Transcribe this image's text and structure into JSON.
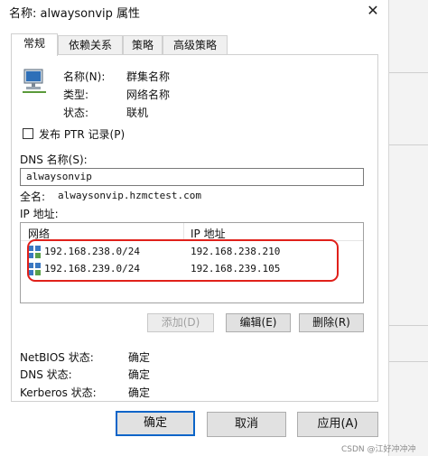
{
  "window": {
    "title": "名称: alwaysonvip 属性",
    "close_glyph": "✕"
  },
  "tabs": [
    {
      "label": "常规",
      "active": true
    },
    {
      "label": "依赖关系",
      "active": false
    },
    {
      "label": "策略",
      "active": false
    },
    {
      "label": "高级策略",
      "active": false
    }
  ],
  "general": {
    "name_label": "名称(N):",
    "name_value": "群集名称",
    "type_label": "类型:",
    "type_value": "网络名称",
    "status_label": "状态:",
    "status_value": "联机",
    "publish_ptr_label": "发布 PTR 记录(P)",
    "publish_ptr_checked": false,
    "dns_name_label": "DNS 名称(S):",
    "dns_name_value": "alwaysonvip",
    "fqdn_label": "全名:",
    "fqdn_value": "alwaysonvip.hzmctest.com",
    "ip_section_label": "IP 地址:"
  },
  "ip_table": {
    "columns": [
      "网络",
      "IP 地址"
    ],
    "rows": [
      {
        "network": "192.168.238.0/24",
        "ip": "192.168.238.210"
      },
      {
        "network": "192.168.239.0/24",
        "ip": "192.168.239.105"
      }
    ]
  },
  "ip_buttons": {
    "add": "添加(D)",
    "edit": "编辑(E)",
    "delete": "删除(R)"
  },
  "status_info": {
    "netbios_label": "NetBIOS 状态:",
    "netbios_value": "确定",
    "dns_label": "DNS 状态:",
    "dns_value": "确定",
    "kerberos_label": "Kerberos 状态:",
    "kerberos_value": "确定"
  },
  "footer": {
    "ok": "确定",
    "cancel": "取消",
    "apply": "应用(A)"
  },
  "watermark": "CSDN @江好冲冲冲",
  "colors": {
    "highlight": "#e0201a",
    "primary_button_border": "#0a64c8"
  }
}
